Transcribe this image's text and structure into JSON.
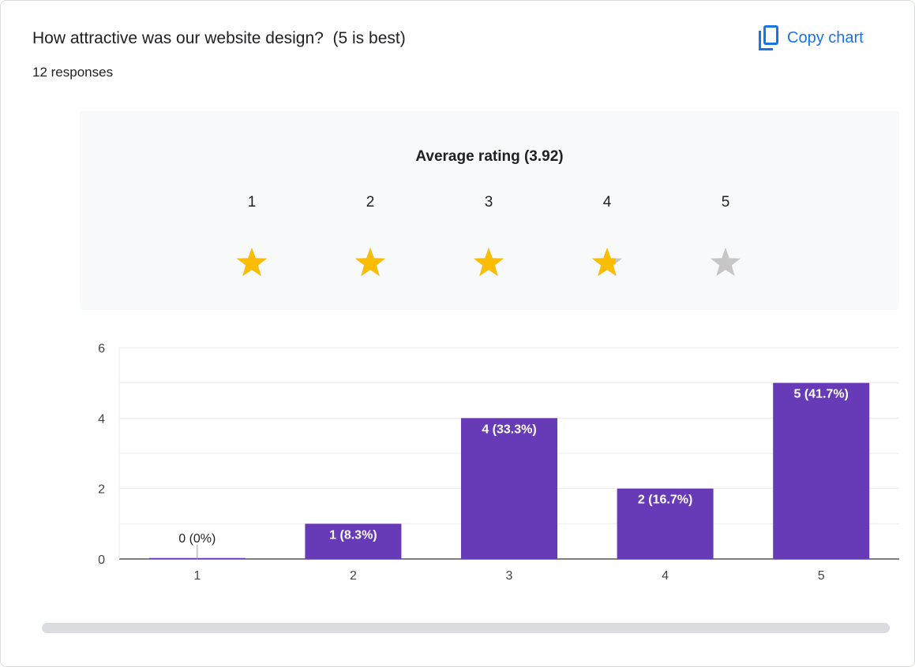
{
  "question": {
    "title": "How attractive was our website design?  (5 is best)",
    "responses": "12 responses"
  },
  "toolbar": {
    "copy_label": "Copy chart",
    "copy_icon": "copy-icon"
  },
  "rating": {
    "label": "Average rating (3.92)",
    "average": 3.92,
    "scale": [
      "1",
      "2",
      "3",
      "4",
      "5"
    ],
    "filled_color": "#fbbc04",
    "empty_color": "#c6c6c6"
  },
  "chart_data": {
    "type": "bar",
    "categories": [
      "1",
      "2",
      "3",
      "4",
      "5"
    ],
    "values": [
      0,
      1,
      4,
      2,
      5
    ],
    "data_labels": [
      "0 (0%)",
      "1 (8.3%)",
      "4 (33.3%)",
      "2 (16.7%)",
      "5 (41.7%)"
    ],
    "y_ticks": [
      "0",
      "2",
      "4",
      "6"
    ],
    "ylim": [
      0,
      6
    ],
    "bar_color": "#673ab7",
    "grid": true
  }
}
